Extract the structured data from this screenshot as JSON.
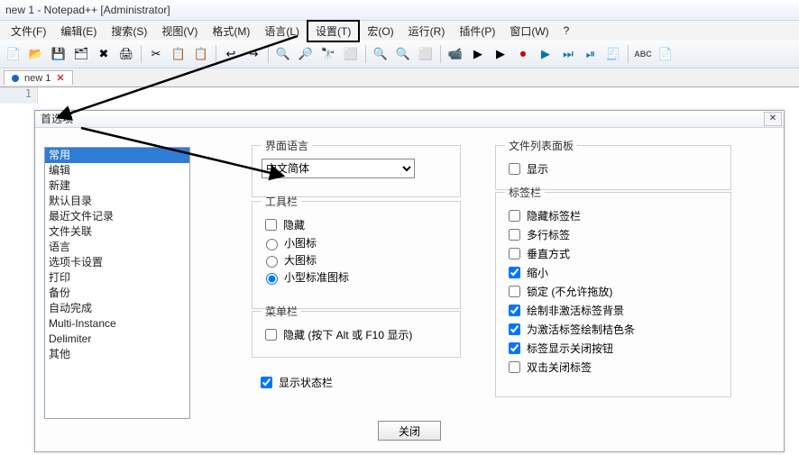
{
  "window": {
    "title": "new  1 - Notepad++  [Administrator]"
  },
  "menu": {
    "file": "文件(F)",
    "edit": "编辑(E)",
    "search": "搜索(S)",
    "view": "视图(V)",
    "format": "格式(M)",
    "language": "语言(L)",
    "settings": "设置(T)",
    "macro": "宏(O)",
    "run": "运行(R)",
    "plugins": "插件(P)",
    "window": "窗口(W)",
    "help": "?"
  },
  "toolbar_icons": [
    "📄",
    "📂",
    "💾",
    "🗂",
    "✖",
    "🖨",
    "✂",
    "📋",
    "📋",
    "↩",
    "↪",
    "🔍",
    "🔎",
    "🔭",
    "⬜",
    "🔍",
    "🔍",
    "⬜",
    "📹",
    "▶",
    "▶",
    "⏺",
    "▶",
    "⏭",
    "⏯",
    "🧾",
    "ABC",
    "📄"
  ],
  "tabs": [
    {
      "label": "new  1"
    }
  ],
  "editor": {
    "line1": "1"
  },
  "dialog": {
    "title": "首选项",
    "categories": [
      "常用",
      "编辑",
      "新建",
      "默认目录",
      "最近文件记录",
      "文件关联",
      "语言",
      "选项卡设置",
      "打印",
      "备份",
      "自动完成",
      "Multi-Instance",
      "Delimiter",
      "其他"
    ],
    "selected_index": 0,
    "ui_lang_group": "界面语言",
    "ui_lang_value": "中文简体",
    "toolbar_group": "工具栏",
    "toolbar": {
      "hide": "隐藏",
      "small": "小图标",
      "large": "大图标",
      "std_small": "小型标准图标"
    },
    "menubar_group": "菜单栏",
    "menubar_hide": "隐藏 (按下 Alt 或 F10 显示)",
    "statusbar": "显示状态栏",
    "filelist_group": "文件列表面板",
    "filelist_show": "显示",
    "tabbar_group": "标签栏",
    "tabbar": {
      "hide": "隐藏标签栏",
      "multi": "多行标签",
      "vertical": "垂直方式",
      "reduce": "缩小",
      "lock": "锁定 (不允许拖放)",
      "draw_inactive": "绘制非激活标签背景",
      "draw_orange": "为激活标签绘制桔色条",
      "show_close": "标签显示关闭按钮",
      "dbl_close": "双击关闭标签"
    },
    "close_btn": "关闭"
  }
}
